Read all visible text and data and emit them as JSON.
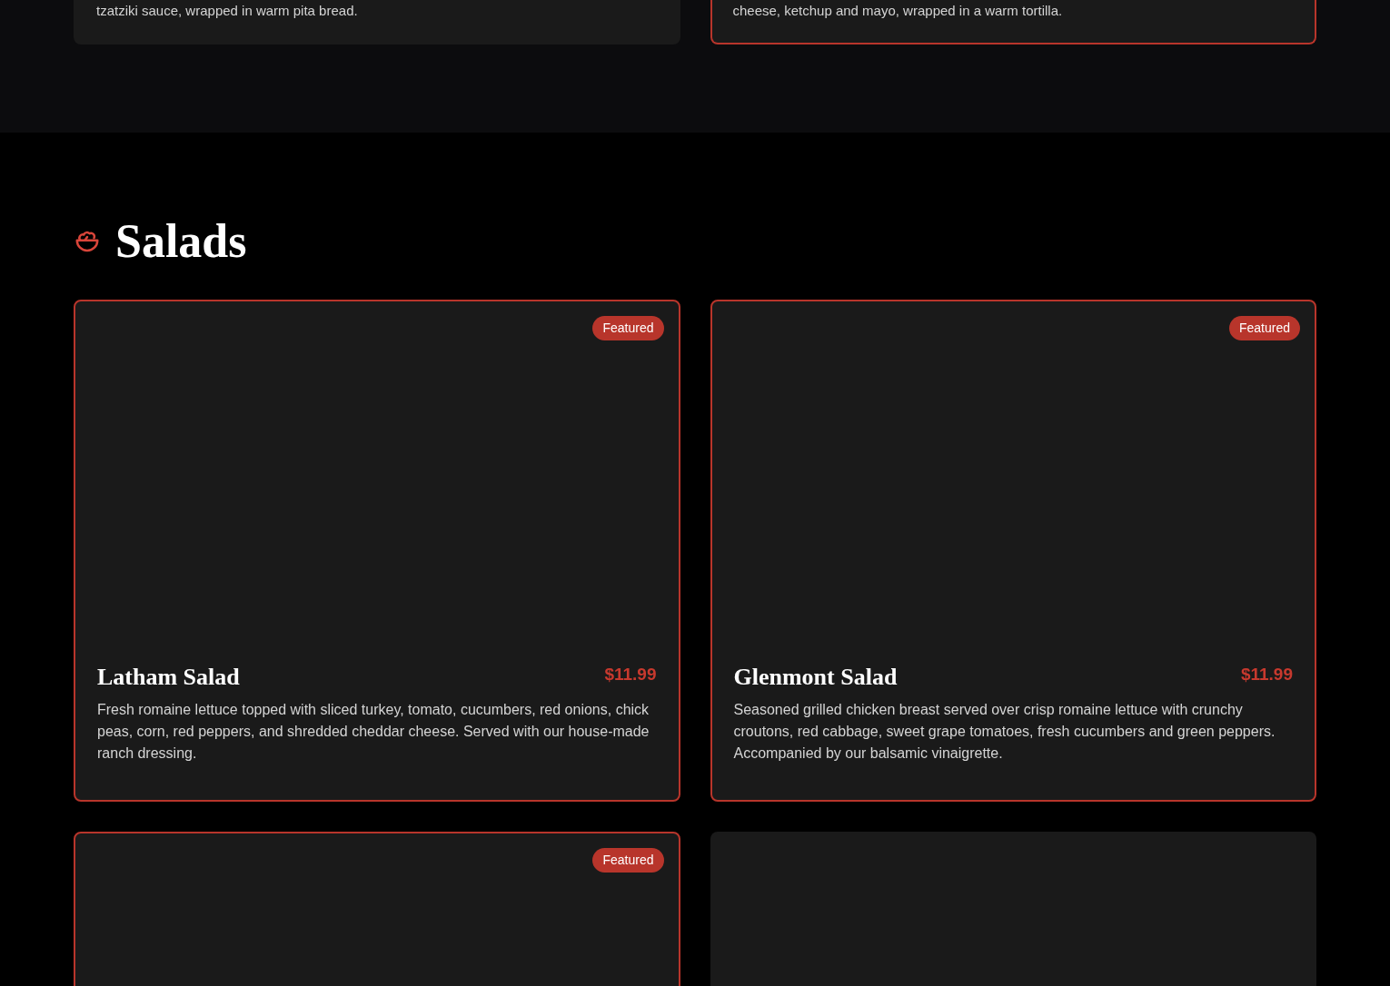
{
  "previous_section": {
    "items": [
      {
        "description": "tzatziki sauce, wrapped in warm pita bread.",
        "featured": false
      },
      {
        "description": "cheese, ketchup and mayo, wrapped in a warm tortilla.",
        "featured": true
      }
    ]
  },
  "salads": {
    "title": "Salads",
    "items": [
      {
        "name": "Latham Salad",
        "price": "$11.99",
        "description": "Fresh romaine lettuce topped with sliced turkey, tomato, cucumbers, red onions, chick peas, corn, red peppers, and shredded cheddar cheese. Served with our house-made ranch dressing.",
        "featured": true,
        "badge": "Featured"
      },
      {
        "name": "Glenmont Salad",
        "price": "$11.99",
        "description": "Seasoned grilled chicken breast served over crisp romaine lettuce with crunchy croutons, red cabbage, sweet grape tomatoes, fresh cucumbers and green peppers. Accompanied by our balsamic vinaigrette.",
        "featured": true,
        "badge": "Featured"
      },
      {
        "featured": true,
        "badge": "Featured"
      },
      {
        "featured": false
      }
    ]
  }
}
